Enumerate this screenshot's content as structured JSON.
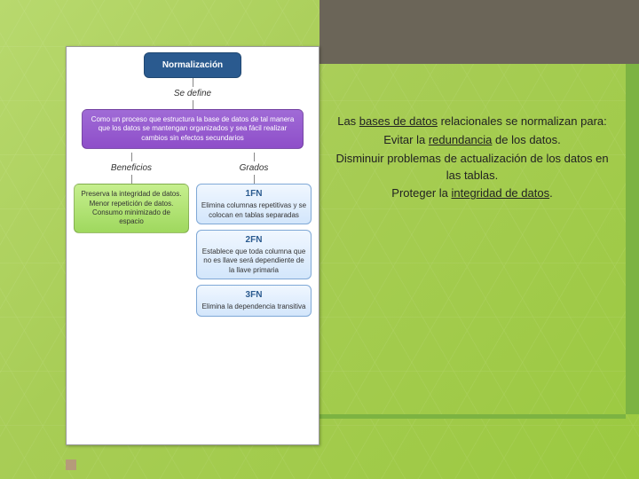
{
  "diagram": {
    "root": "Normalización",
    "define_label": "Se define",
    "definition": "Como un proceso que estructura la base de datos de tal manera que los datos se mantengan organizados y sea fácil realizar cambios sin efectos secundarios",
    "beneficios_label": "Beneficios",
    "grados_label": "Grados",
    "beneficios": "Preserva la integridad de datos.\nMenor repetición de datos.\nConsumo minimizado de espacio",
    "forms": [
      {
        "title": "1FN",
        "desc": "Elimina columnas repetitivas y se colocan en tablas separadas"
      },
      {
        "title": "2FN",
        "desc": "Establece que toda columna que no es llave será dependiente de la llave primaria"
      },
      {
        "title": "3FN",
        "desc": "Elimina la dependencia transitiva"
      }
    ]
  },
  "text": {
    "line1_a": "Las ",
    "line1_link": "bases de datos",
    "line1_b": " relacionales se normalizan para:",
    "line2_a": "Evitar la ",
    "line2_link": "redundancia",
    "line2_b": " de los datos.",
    "line3": "Disminuir problemas de actualización de los datos en las tablas.",
    "line4_a": "Proteger la ",
    "line4_link": "integridad de datos",
    "line4_b": "."
  }
}
